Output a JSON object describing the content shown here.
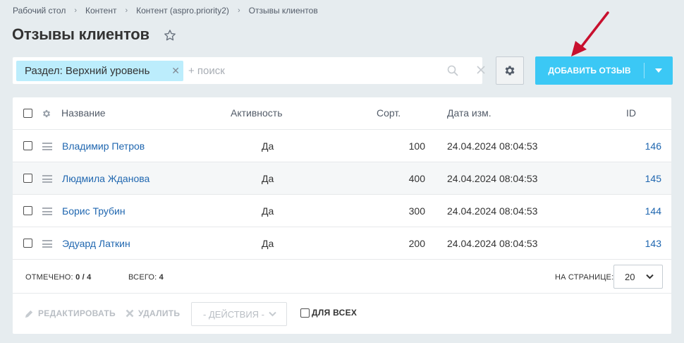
{
  "breadcrumb": [
    "Рабочий стол",
    "Контент",
    "Контент (aspro.priority2)",
    "Отзывы клиентов"
  ],
  "page_title": "Отзывы клиентов",
  "filter": {
    "chip_label": "Раздел: Верхний уровень",
    "search_placeholder": "+ поиск"
  },
  "add_button": {
    "label": "ДОБАВИТЬ ОТЗЫВ"
  },
  "table": {
    "columns": {
      "name": "Название",
      "active": "Активность",
      "sort": "Сорт.",
      "date": "Дата изм.",
      "id": "ID"
    },
    "rows": [
      {
        "name": "Владимир Петров",
        "active": "Да",
        "sort": "100",
        "date": "24.04.2024 08:04:53",
        "id": "146"
      },
      {
        "name": "Людмила Жданова",
        "active": "Да",
        "sort": "400",
        "date": "24.04.2024 08:04:53",
        "id": "145"
      },
      {
        "name": "Борис Трубин",
        "active": "Да",
        "sort": "300",
        "date": "24.04.2024 08:04:53",
        "id": "144"
      },
      {
        "name": "Эдуард Латкин",
        "active": "Да",
        "sort": "200",
        "date": "24.04.2024 08:04:53",
        "id": "143"
      }
    ]
  },
  "footer": {
    "checked_label": "ОТМЕЧЕНО:",
    "checked_value": "0 / 4",
    "total_label": "ВСЕГО:",
    "total_value": "4",
    "per_page_label": "НА СТРАНИЦЕ:",
    "per_page_value": "20"
  },
  "actions": {
    "edit_label": "РЕДАКТИРОВАТЬ",
    "delete_label": "УДАЛИТЬ",
    "select_label": "- ДЕЙСТВИЯ -",
    "for_all_label": "ДЛЯ ВСЕХ"
  },
  "colors": {
    "accent": "#3bc8f5",
    "chip": "#bcedfc",
    "link": "#2067b0",
    "arrow": "#c8102e"
  }
}
